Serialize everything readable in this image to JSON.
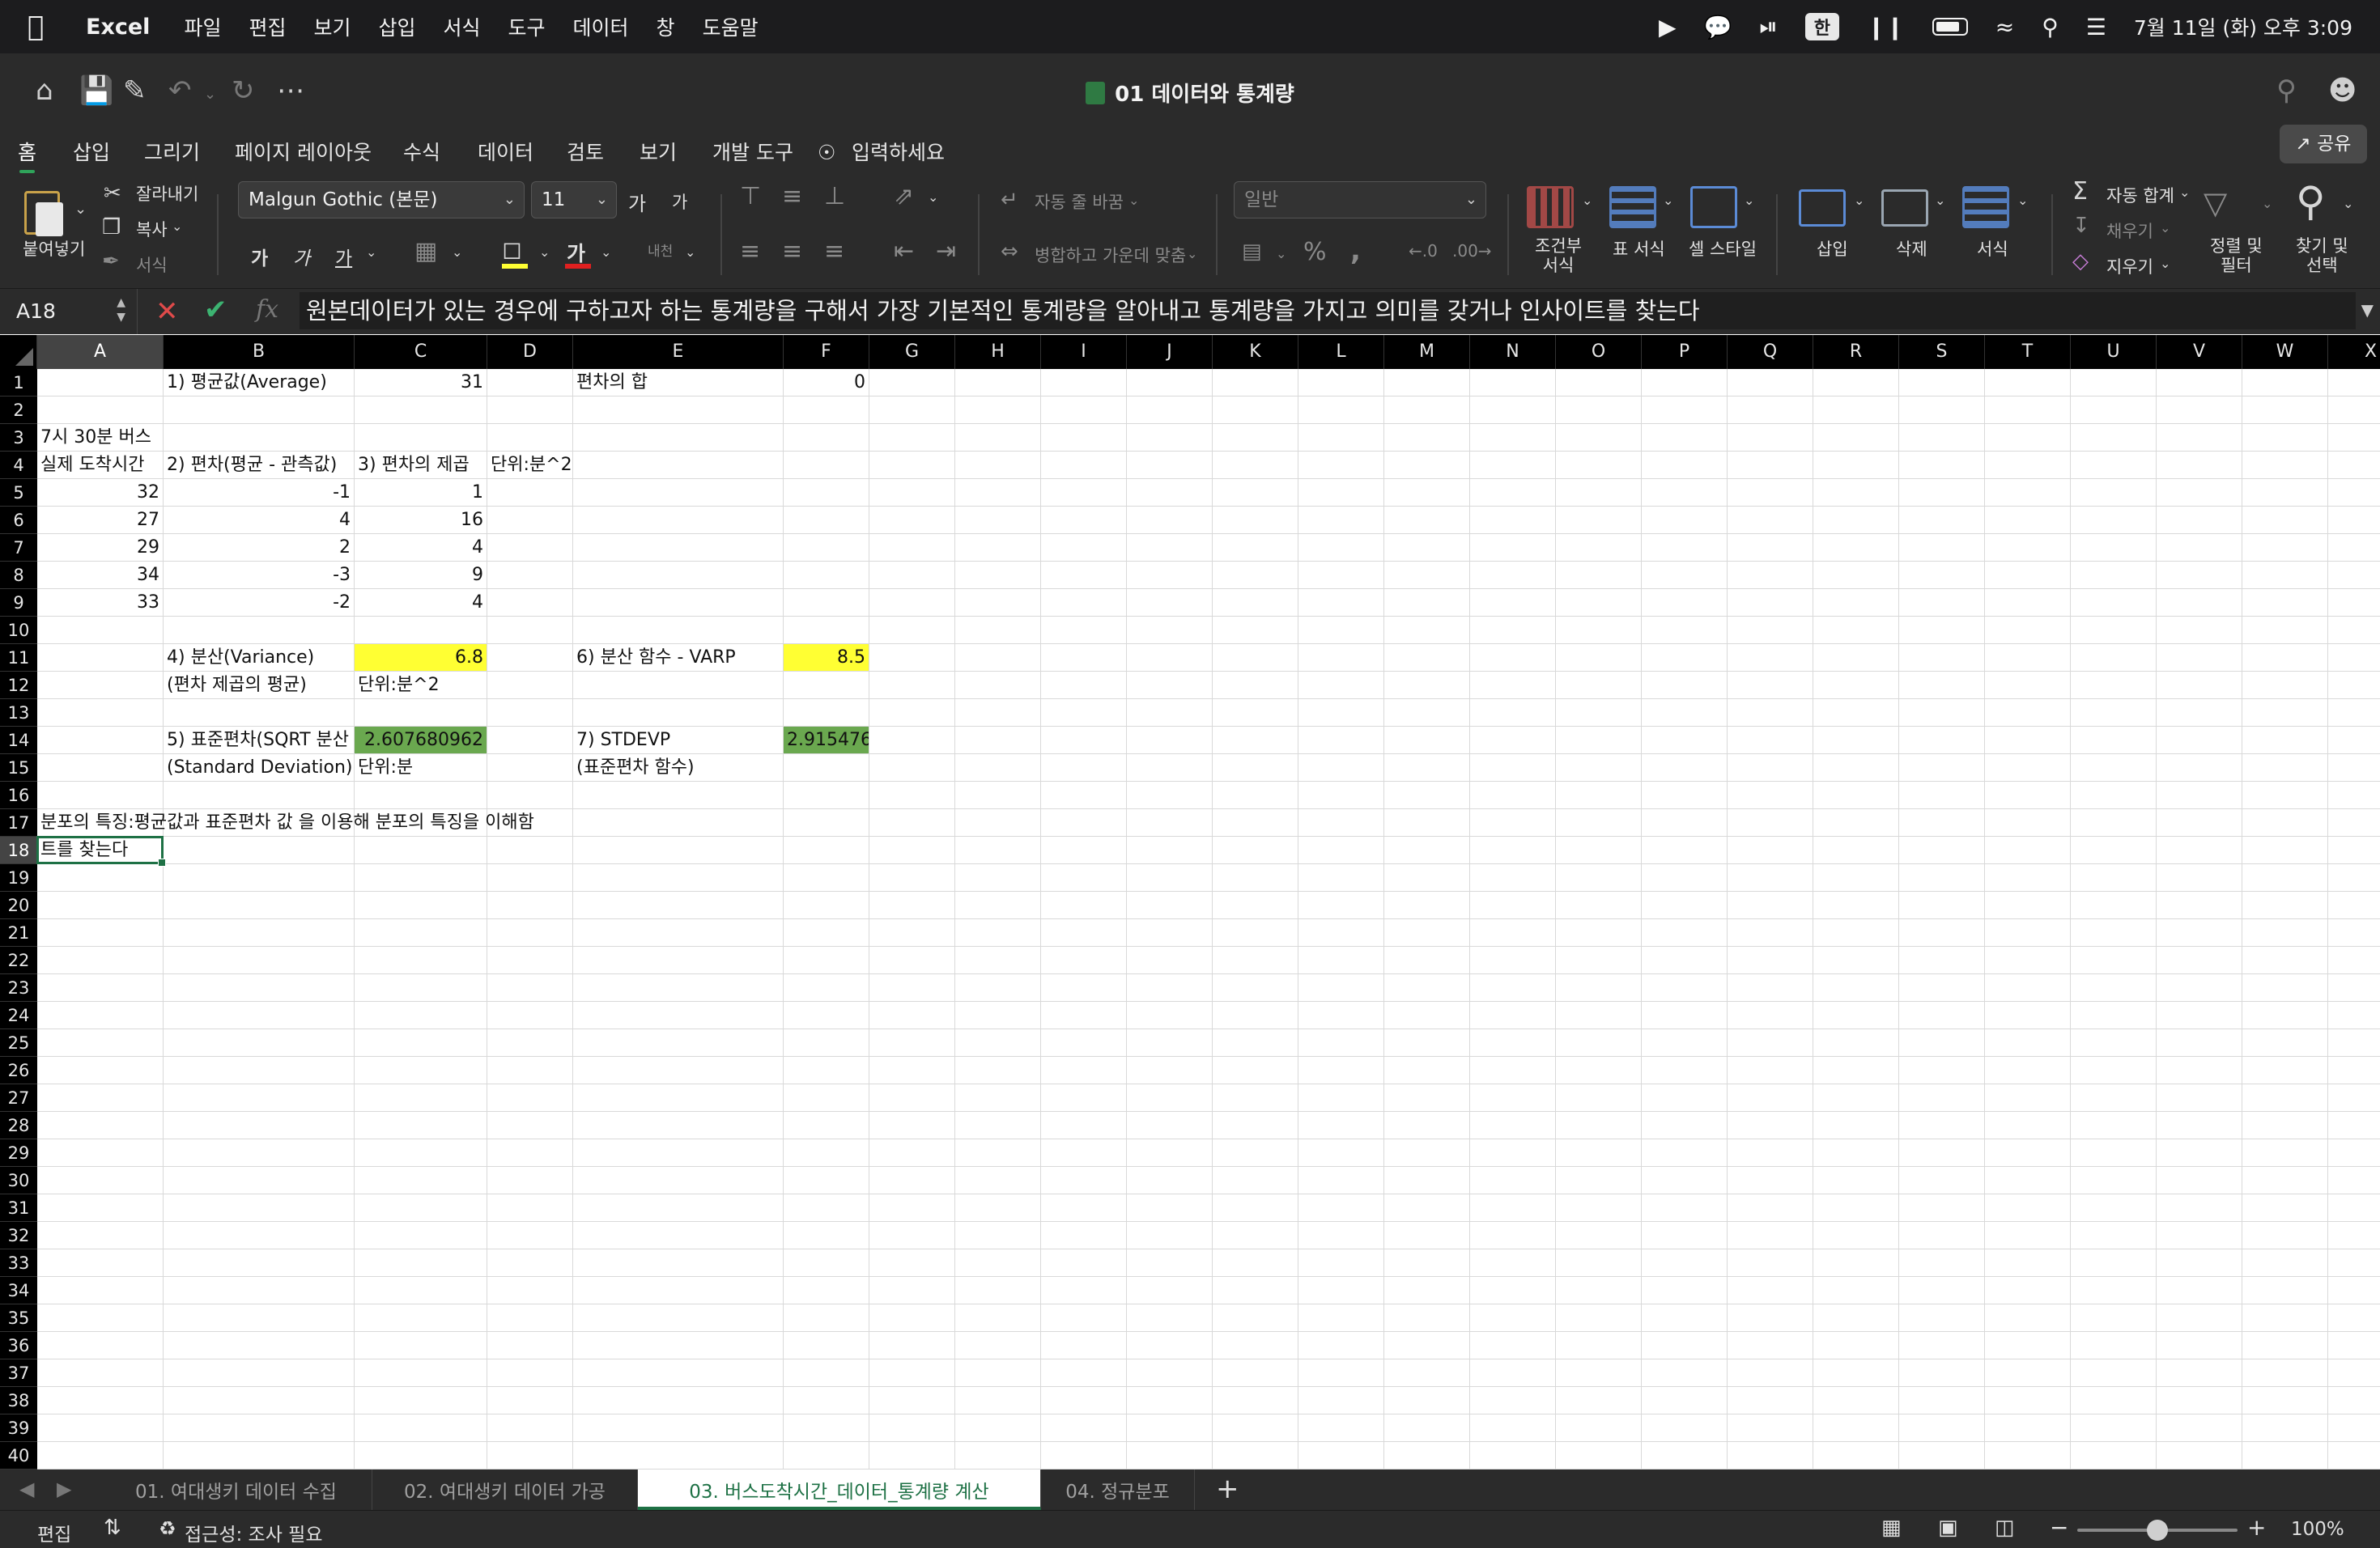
{
  "menubar": {
    "app_name": "Excel",
    "menus": [
      "파일",
      "편집",
      "보기",
      "삽입",
      "서식",
      "도구",
      "데이터",
      "창",
      "도움말"
    ],
    "ime_label": "한",
    "clock": "7월 11일 (화) 오후 3:09"
  },
  "window": {
    "title": "01 데이터와 통계량"
  },
  "ribbon": {
    "tabs": [
      "홈",
      "삽입",
      "그리기",
      "페이지 레이아웃",
      "수식",
      "데이터",
      "검토",
      "보기",
      "개발 도구"
    ],
    "active_tab": "홈",
    "tell_me": "입력하세요",
    "share": "공유",
    "clipboard": {
      "paste": "붙여넣기",
      "cut": "잘라내기",
      "copy": "복사",
      "format": "서식"
    },
    "font": {
      "name": "Malgun Gothic (본문)",
      "size": "11",
      "bold": "가",
      "italic": "가",
      "underline": "가",
      "grow": "가",
      "shrink": "가",
      "color_a": "가",
      "phonetic": "내천"
    },
    "alignment": {
      "wrap": "자동 줄 바꿈",
      "merge": "병합하고 가운데 맞춤"
    },
    "number": {
      "format": "일반",
      "percent": "%",
      "comma": ","
    },
    "styles": {
      "conditional": "조건부\n서식",
      "table": "표 서식",
      "cell": "셀 스타일"
    },
    "cells": {
      "insert": "삽입",
      "delete": "삭제",
      "format": "서식"
    },
    "editing": {
      "autosum": "자동 합계",
      "fill": "채우기",
      "clear": "지우기",
      "sort": "정렬 및\n필터",
      "find": "찾기 및\n선택"
    }
  },
  "formula_bar": {
    "name_box": "A18",
    "content": "원본데이터가 있는 경우에 구하고자 하는 통계량을 구해서 가장 기본적인 통계량을 알아내고 통계량을 가지고 의미를 갖거나 인사이트를 찾는다"
  },
  "sheet": {
    "columns": [
      "A",
      "B",
      "C",
      "D",
      "E",
      "F",
      "G",
      "H",
      "I",
      "J",
      "K",
      "L",
      "M",
      "N",
      "O",
      "P",
      "Q",
      "R",
      "S",
      "T",
      "U",
      "V",
      "W",
      "X"
    ],
    "selected_column": "A",
    "row_count": 40,
    "selected_row": 18,
    "cells": [
      {
        "ref": "B1",
        "text": "1) 평균값(Average)"
      },
      {
        "ref": "C1",
        "text": "31",
        "num": true
      },
      {
        "ref": "E1",
        "text": "편차의 합"
      },
      {
        "ref": "F1",
        "text": "0",
        "num": true
      },
      {
        "ref": "A3",
        "text": "7시 30분 버스"
      },
      {
        "ref": "A4",
        "text": "실제 도착시간"
      },
      {
        "ref": "B4",
        "text": "2) 편차(평균 - 관측값)"
      },
      {
        "ref": "C4",
        "text": "3) 편차의 제곱"
      },
      {
        "ref": "D4",
        "text": "단위:분^2"
      },
      {
        "ref": "A5",
        "text": "32",
        "num": true
      },
      {
        "ref": "B5",
        "text": "-1",
        "num": true
      },
      {
        "ref": "C5",
        "text": "1",
        "num": true
      },
      {
        "ref": "A6",
        "text": "27",
        "num": true
      },
      {
        "ref": "B6",
        "text": "4",
        "num": true
      },
      {
        "ref": "C6",
        "text": "16",
        "num": true
      },
      {
        "ref": "A7",
        "text": "29",
        "num": true
      },
      {
        "ref": "B7",
        "text": "2",
        "num": true
      },
      {
        "ref": "C7",
        "text": "4",
        "num": true
      },
      {
        "ref": "A8",
        "text": "34",
        "num": true
      },
      {
        "ref": "B8",
        "text": "-3",
        "num": true
      },
      {
        "ref": "C8",
        "text": "9",
        "num": true
      },
      {
        "ref": "A9",
        "text": "33",
        "num": true
      },
      {
        "ref": "B9",
        "text": "-2",
        "num": true
      },
      {
        "ref": "C9",
        "text": "4",
        "num": true
      },
      {
        "ref": "B11",
        "text": "4) 분산(Variance)"
      },
      {
        "ref": "C11",
        "text": "6.8",
        "num": true,
        "fill": "#ffff33"
      },
      {
        "ref": "E11",
        "text": "6) 분산 함수 - VARP"
      },
      {
        "ref": "F11",
        "text": "8.5",
        "num": true,
        "fill": "#ffff33"
      },
      {
        "ref": "B12",
        "text": "(편차 제곱의 평균)"
      },
      {
        "ref": "C12",
        "text": "단위:분^2"
      },
      {
        "ref": "B14",
        "text": "5) 표준편차(SQRT 분산"
      },
      {
        "ref": "C14",
        "text": "2.607680962",
        "num": true,
        "fill": "#6aa84f"
      },
      {
        "ref": "E14",
        "text": "7) STDEVP"
      },
      {
        "ref": "F14",
        "text": "2.915476",
        "num": true,
        "fill": "#6aa84f"
      },
      {
        "ref": "B15",
        "text": "(Standard Deviation)"
      },
      {
        "ref": "C15",
        "text": "단위:분"
      },
      {
        "ref": "E15",
        "text": "(표준편차 함수)"
      },
      {
        "ref": "A17",
        "text": "분포의 특징:평균값과 표준편차 값 을 이용해 분포의 특징을 이해함"
      },
      {
        "ref": "A18",
        "text": "트를 찾는다"
      }
    ]
  },
  "sheet_tabs": {
    "tabs": [
      "01. 여대생키 데이터 수집",
      "02. 여대생키 데이터 가공",
      "03. 버스도착시간_데이터_통계량 계산",
      "04. 정규분포"
    ],
    "active_index": 2,
    "add": "+"
  },
  "status_bar": {
    "mode": "편집",
    "accessibility": "접근성: 조사 필요",
    "zoom": "100%",
    "zoom_value": 100,
    "zoom_minus": "−",
    "zoom_plus": "+"
  }
}
